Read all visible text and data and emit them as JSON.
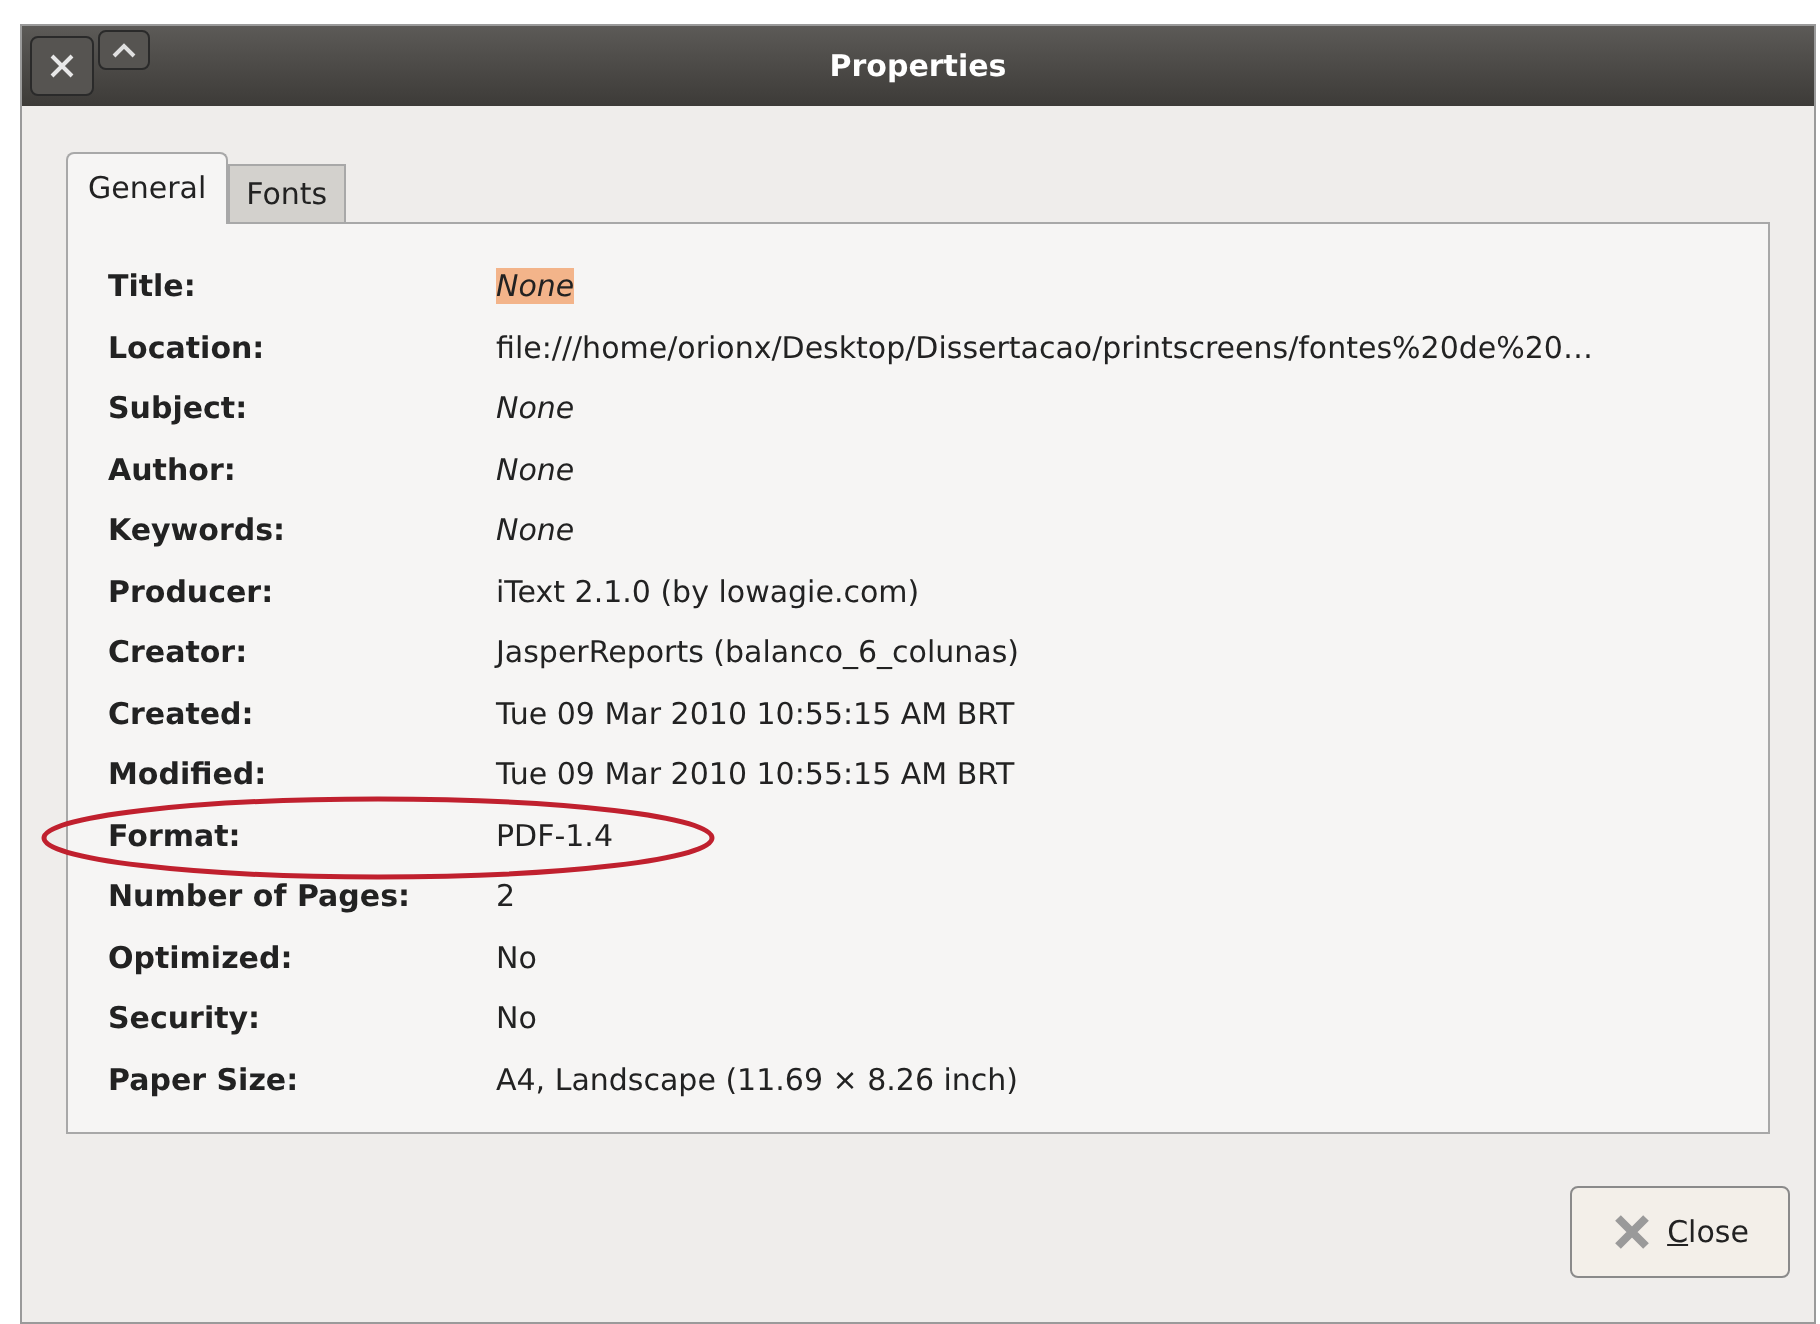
{
  "window": {
    "title": "Properties"
  },
  "tabs": [
    {
      "label": "General",
      "selected": true
    },
    {
      "label": "Fonts",
      "selected": false
    }
  ],
  "properties": [
    {
      "label": "Title:",
      "value": "None",
      "italic": true,
      "highlighted": true
    },
    {
      "label": "Location:",
      "value": "file:///home/orionx/Desktop/Dissertacao/printscreens/fontes%20de%20…",
      "italic": false,
      "highlighted": false
    },
    {
      "label": "Subject:",
      "value": "None",
      "italic": true,
      "highlighted": false
    },
    {
      "label": "Author:",
      "value": "None",
      "italic": true,
      "highlighted": false
    },
    {
      "label": "Keywords:",
      "value": "None",
      "italic": true,
      "highlighted": false
    },
    {
      "label": "Producer:",
      "value": "iText 2.1.0 (by lowagie.com)",
      "italic": false,
      "highlighted": false
    },
    {
      "label": "Creator:",
      "value": "JasperReports (balanco_6_colunas)",
      "italic": false,
      "highlighted": false
    },
    {
      "label": "Created:",
      "value": "Tue 09 Mar 2010 10:55:15 AM BRT",
      "italic": false,
      "highlighted": false
    },
    {
      "label": "Modified:",
      "value": "Tue 09 Mar 2010 10:55:15 AM BRT",
      "italic": false,
      "highlighted": false
    },
    {
      "label": "Format:",
      "value": "PDF-1.4",
      "italic": false,
      "highlighted": false
    },
    {
      "label": "Number of Pages:",
      "value": "2",
      "italic": false,
      "highlighted": false
    },
    {
      "label": "Optimized:",
      "value": "No",
      "italic": false,
      "highlighted": false
    },
    {
      "label": "Security:",
      "value": "No",
      "italic": false,
      "highlighted": false
    },
    {
      "label": "Paper Size:",
      "value": "A4, Landscape (11.69 × 8.26 inch)",
      "italic": false,
      "highlighted": false
    }
  ],
  "buttons": [
    {
      "label": "Close"
    }
  ]
}
